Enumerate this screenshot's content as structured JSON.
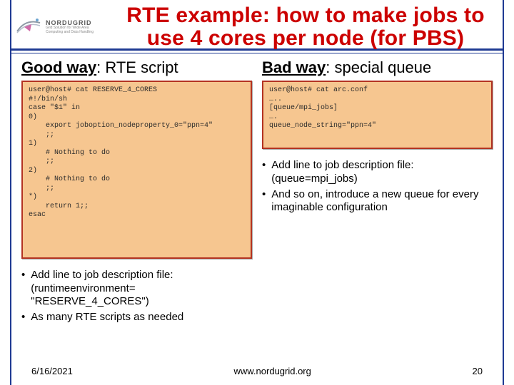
{
  "logo": {
    "brand": "NORDUGRID",
    "tagline": "Grid Solution for Wide Area Computing and Data Handling"
  },
  "title_line1": "RTE example: how to make jobs to",
  "title_line2": "use 4 cores per node (for PBS)",
  "left": {
    "heading_uw": "Good way",
    "heading_rest": ": RTE script",
    "code": "user@host# cat RESERVE_4_CORES\n#!/bin/sh\ncase \"$1\" in\n0)\n    export joboption_nodeproperty_0=\"ppn=4\"\n    ;;\n1)\n    # Nothing to do\n    ;;\n2)\n    # Nothing to do\n    ;;\n*)\n    return 1;;\nesac",
    "bullets": [
      "Add line to job description file:  (runtimeenvironment=  \"RESERVE_4_CORES\")",
      "As many RTE scripts as needed"
    ]
  },
  "right": {
    "heading_uw": "Bad way",
    "heading_rest": ": special queue",
    "code": "user@host# cat arc.conf\n…..\n[queue/mpi_jobs]\n….\nqueue_node_string=\"ppn=4\"\n",
    "bullets": [
      "Add line to job description file:  (queue=mpi_jobs)",
      "And so on, introduce a new queue for every imaginable configuration"
    ]
  },
  "footer": {
    "date": "6/16/2021",
    "url": "www.nordugrid.org",
    "page": "20"
  }
}
